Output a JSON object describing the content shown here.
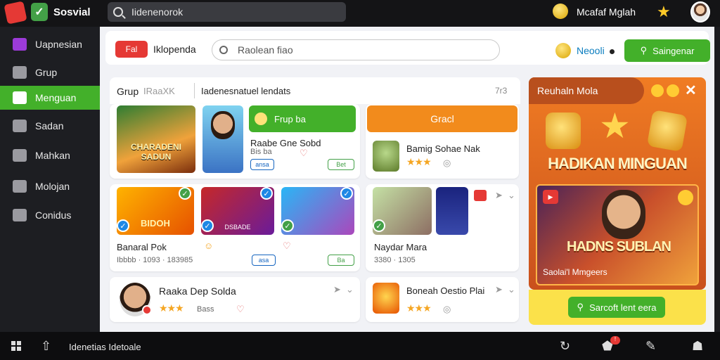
{
  "topbar": {
    "app_title": "Sosvial",
    "search_value": "Iidenenorok",
    "user_name": "Mcafaf Mglah"
  },
  "sidebar": {
    "items": [
      {
        "label": "Uapnesian",
        "icon": "app-icon"
      },
      {
        "label": "Grup",
        "icon": "image-icon"
      },
      {
        "label": "Menguan",
        "icon": "grid-icon",
        "active": true
      },
      {
        "label": "Sadan",
        "icon": "shield-icon"
      },
      {
        "label": "Mahkan",
        "icon": "document-icon"
      },
      {
        "label": "Molojan",
        "icon": "camera-icon"
      },
      {
        "label": "Conidus",
        "icon": "bird-icon"
      }
    ]
  },
  "subheader": {
    "pill": "Fal",
    "title": "Iklopenda",
    "search_placeholder": "Raolean fiao",
    "status": "Neooli",
    "button": "Saingenar"
  },
  "section": {
    "tab": "Grup",
    "tab_sub": "IRaaXK",
    "title": "Iadenesnatuel lendats",
    "count": "7r3"
  },
  "cards": {
    "featured": {
      "thumb_title": "CHARADENI SADUN",
      "btn_green": "Frup ba",
      "title": "Raabe Gne Sobd",
      "sub": "Bis ba",
      "badge_blue": "ansa",
      "badge_green": "Bet"
    },
    "groc": {
      "btn": "Gracl",
      "title": "Bamig Sohae Nak",
      "stars": "★★★"
    },
    "trio": {
      "label1": "BIDOH",
      "label2": "DSBADE",
      "title": "Banaral Pok",
      "sub": "Ibbbb · 1093 · 183985",
      "badge_blue": "asa",
      "badge_green": "Ba"
    },
    "duo": {
      "title": "Naydar Mara",
      "sub": "3380 · 1305"
    },
    "person1": {
      "title": "Raaka Dep Solda",
      "stars": "★★★",
      "sub": "Bass"
    },
    "person2": {
      "title": "Boneah Oestio Plai",
      "stars": "★★★"
    }
  },
  "promo": {
    "tab": "Reuhaln Mola",
    "headline": "HADIKAN MINGUAN",
    "img_title": "HADNS SUBLAN",
    "img_sub": "Saolai'l Mmgeers",
    "button": "Sarcoft lent eera"
  },
  "taskbar": {
    "text": "Idenetias Idetoale"
  },
  "colors": {
    "accent_green": "#43b02a",
    "promo_orange": "#f07c23",
    "accent_red": "#e53935"
  }
}
